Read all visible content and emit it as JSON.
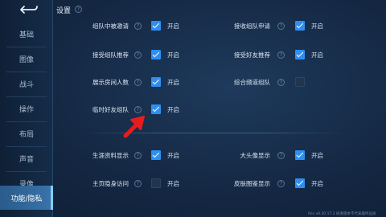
{
  "sidebar": {
    "items": [
      {
        "label": "基础"
      },
      {
        "label": "图像"
      },
      {
        "label": "战斗"
      },
      {
        "label": "操作"
      },
      {
        "label": "布局"
      },
      {
        "label": "声音"
      },
      {
        "label": "录像"
      },
      {
        "label": "功能/隐私"
      }
    ],
    "active_index": 7
  },
  "header": {
    "title": "设置",
    "help": "?"
  },
  "toggle_on_text": "开启",
  "settings": {
    "left": [
      {
        "label": "组队中被邀请",
        "checked": true
      },
      {
        "label": "接受组队推荐",
        "checked": true
      },
      {
        "label": "展示房间人数",
        "checked": true
      },
      {
        "label": "临时好友组队",
        "checked": true
      },
      {
        "label": "生涯资料显示",
        "checked": true
      },
      {
        "label": "主页隐身访问",
        "checked": false
      }
    ],
    "right": [
      {
        "label": "接收组队申请",
        "checked": true
      },
      {
        "label": "接受好友推荐",
        "checked": true
      },
      {
        "label": "综合频道组队",
        "checked": false
      },
      {
        "label": "大头像显示",
        "checked": true
      },
      {
        "label": "皮肤图鉴显示",
        "checked": true
      }
    ]
  },
  "footer": {
    "version": "Res v8.30.17.2 研发版本不代表最终品质"
  },
  "colors": {
    "accent": "#2f8ff0",
    "arrow": "#e81c1c",
    "active_tab": "#3a74aa"
  },
  "icons": {
    "back": "back-arrow-icon",
    "help": "help-circle-icon"
  }
}
